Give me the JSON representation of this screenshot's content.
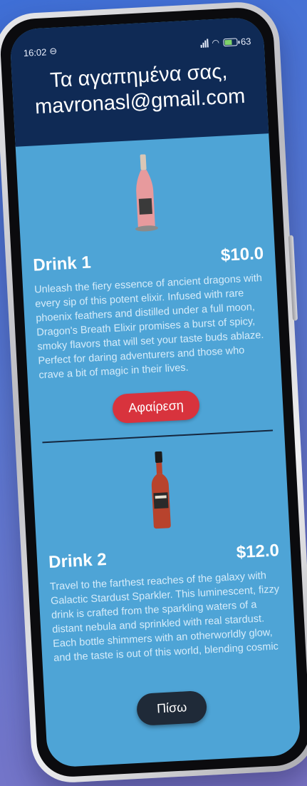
{
  "status_bar": {
    "time": "16:02",
    "battery": "63"
  },
  "header": {
    "title": "Τα αγαπημένα σας, mavronasl@gmail.com"
  },
  "drinks": [
    {
      "name": "Drink 1",
      "price": "$10.0",
      "description": "Unleash the fiery essence of ancient dragons with every sip of this potent elixir. Infused with rare phoenix feathers and distilled under a full moon, Dragon's Breath Elixir promises a burst of spicy, smoky flavors that will set your taste buds ablaze. Perfect for daring adventurers and those who crave a bit of magic in their lives.",
      "remove_label": "Αφαίρεση",
      "bottle_color": "#e79a9d"
    },
    {
      "name": "Drink 2",
      "price": "$12.0",
      "description": "Travel to the farthest reaches of the galaxy with Galactic Stardust Sparkler. This luminescent, fizzy drink is crafted from the sparkling waters of a distant nebula and sprinkled with real stardust. Each bottle shimmers with an otherworldly glow, and the taste is out of this world, blending cosmic",
      "bottle_color": "#b8432d"
    }
  ],
  "footer": {
    "back_label": "Πίσω"
  },
  "colors": {
    "header_bg": "#0f2a55",
    "screen_bg": "#4ea4d6",
    "remove_button": "#d8333d",
    "back_button": "#1f2a38"
  }
}
